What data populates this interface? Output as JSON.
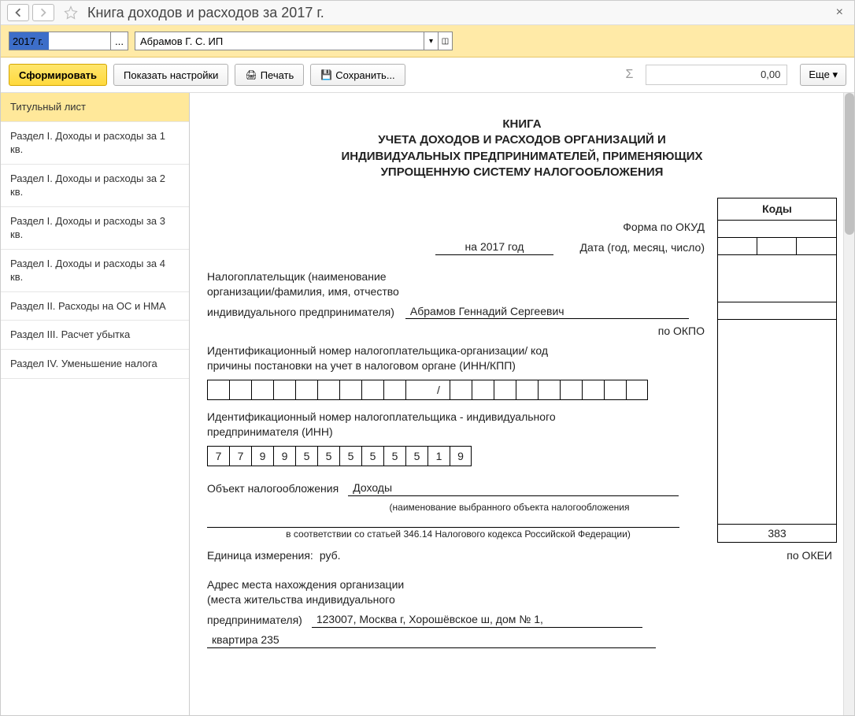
{
  "title": "Книга доходов и расходов за 2017 г.",
  "period_value": "2017 г.",
  "org_value": "Абрамов Г. С. ИП",
  "toolbar": {
    "form": "Сформировать",
    "show_settings": "Показать настройки",
    "print": "Печать",
    "save": "Сохранить...",
    "sum": "0,00",
    "more": "Еще"
  },
  "sidebar": [
    "Титульный лист",
    "Раздел I. Доходы и расходы за 1 кв.",
    "Раздел I. Доходы и расходы за 2 кв.",
    "Раздел I. Доходы и расходы за 3 кв.",
    "Раздел I. Доходы и расходы за 4 кв.",
    "Раздел II. Расходы на ОС и НМА",
    "Раздел III. Расчет убытка",
    "Раздел IV. Уменьшение налога"
  ],
  "report": {
    "top": "КНИГА",
    "sub1": "УЧЕТА ДОХОДОВ И РАСХОДОВ ОРГАНИЗАЦИЙ И",
    "sub2": "ИНДИВИДУАЛЬНЫХ ПРЕДПРИНИМАТЕЛЕЙ, ПРИМЕНЯЮЩИХ",
    "sub3": "УПРОЩЕННУЮ СИСТЕМУ НАЛОГООБЛОЖЕНИЯ",
    "codes_header": "Коды",
    "okud_label": "Форма по ОКУД",
    "year_value": "на 2017 год",
    "date_label": "Дата (год, месяц, число)",
    "taxpayer_label1": "Налогоплательщик (наименование",
    "taxpayer_label2": "организации/фамилия, имя, отчество",
    "taxpayer_label3": "индивидуального предпринимателя)",
    "taxpayer_name": "Абрамов Геннадий Сергеевич",
    "okpo_label": "по ОКПО",
    "inn_org_label1": "Идентификационный номер налогоплательщика-организации/ код",
    "inn_org_label2": "причины постановки на учет в налоговом органе (ИНН/КПП)",
    "inn_ip_label1": "Идентификационный номер налогоплательщика - индивидуального",
    "inn_ip_label2": "предпринимателя (ИНН)",
    "inn_digits": [
      "7",
      "7",
      "9",
      "9",
      "5",
      "5",
      "5",
      "5",
      "5",
      "5",
      "1",
      "9"
    ],
    "object_label": "Объект налогообложения",
    "object_value": "Доходы",
    "object_note": "(наименование выбранного объекта налогообложения",
    "object_note2": "в соответствии со статьей 346.14 Налогового кодекса Российской Федерации)",
    "unit_label": "Единица измерения:",
    "unit_value": "руб.",
    "okei_label": "по ОКЕИ",
    "okei_value": "383",
    "addr_label1": "Адрес места нахождения организации",
    "addr_label2": "(места жительства индивидуального",
    "addr_label3": "предпринимателя)",
    "addr_value1": "123007, Москва г, Хорошёвское ш, дом № 1,",
    "addr_value2": "квартира 235"
  }
}
